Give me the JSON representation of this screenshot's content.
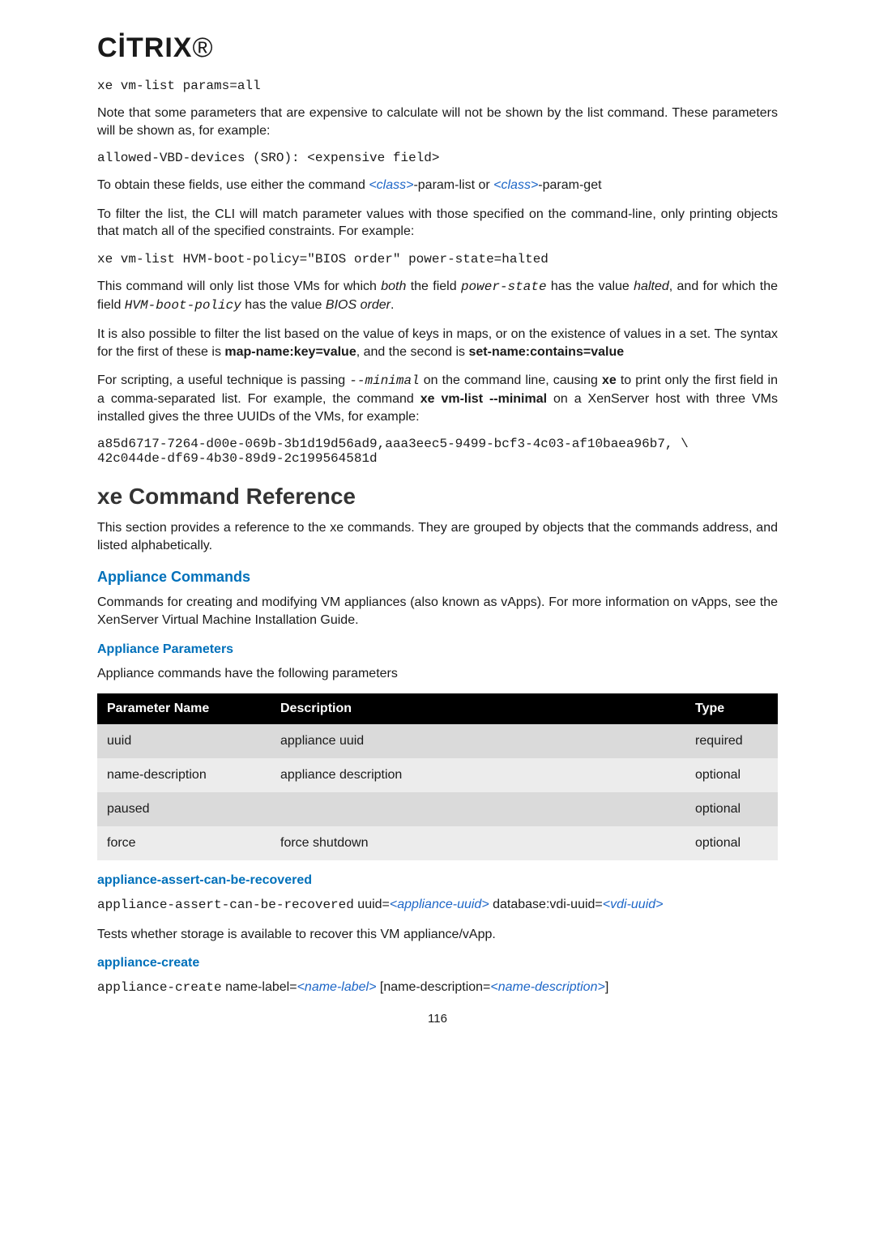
{
  "logo": "CİTRIX",
  "code_block_1": "xe vm-list params=all",
  "para_1": "Note that some parameters that are expensive to calculate will not be shown by the list command. These parameters will be shown as, for example:",
  "code_block_2": "allowed-VBD-devices (SRO): <expensive field>",
  "para_2": {
    "t0": "To obtain these fields, use either the command ",
    "c1": "<class>",
    "t1": "-param-list or ",
    "c2": "<class>",
    "t2": "-param-get"
  },
  "para_3": "To filter the list, the CLI will match parameter values with those specified on the command-line, only printing objects that match all of the specified constraints. For example:",
  "code_block_3": "xe vm-list HVM-boot-policy=\"BIOS order\" power-state=halted",
  "para_4": {
    "t0": "This command will only list those VMs for which ",
    "b0": "both",
    "t1": " the field ",
    "c0": "power-state",
    "t2": " has the value ",
    "i0": "halted",
    "t3": ", and for which the field ",
    "c1": "HVM-boot-policy",
    "t4": " has the value ",
    "i1": "BIOS order",
    "t5": "."
  },
  "para_5": {
    "t0": "It is also possible to filter the list based on the value of keys in maps, or on the existence of values in a set. The syntax for the first of these is ",
    "b0": "map-name:key=value",
    "t1": ", and the second is ",
    "b1": "set-name:contains=value"
  },
  "para_6": {
    "t0": "For scripting, a useful technique is passing ",
    "c0": "--minimal",
    "t1": " on the command line, causing ",
    "b0": "xe",
    "t2": " to print only the first field in a comma-separated list. For example, the command ",
    "b1": "xe vm-list --minimal",
    "t3": " on a XenServer host with three VMs installed gives the three UUIDs of the VMs, for example:"
  },
  "code_block_4": "a85d6717-7264-d00e-069b-3b1d19d56ad9,aaa3eec5-9499-bcf3-4c03-af10baea96b7, \\\n42c044de-df69-4b30-89d9-2c199564581d",
  "h2_ref": "xe Command Reference",
  "para_7": "This section provides a reference to the xe commands. They are grouped by objects that the commands address, and listed alphabetically.",
  "h3_appliance": "Appliance Commands",
  "para_8": "Commands for creating and modifying VM appliances (also known as vApps). For more information on vApps, see the XenServer Virtual Machine Installation Guide.",
  "h4_params": "Appliance Parameters",
  "para_9": "Appliance commands have the following parameters",
  "table": {
    "head": {
      "c0": "Parameter Name",
      "c1": "Description",
      "c2": "Type"
    },
    "rows": [
      {
        "c0": "uuid",
        "c1": "appliance uuid",
        "c2": "required"
      },
      {
        "c0": "name-description",
        "c1": "appliance description",
        "c2": "optional"
      },
      {
        "c0": "paused",
        "c1": "",
        "c2": "optional"
      },
      {
        "c0": "force",
        "c1": "force shutdown",
        "c2": "optional"
      }
    ]
  },
  "h4_assert": "appliance-assert-can-be-recovered",
  "cmd_assert": {
    "c0": "appliance-assert-can-be-recovered",
    "t0": " uuid=",
    "a0": "<appliance-uuid>",
    "t1": " database:vdi-uuid=",
    "a1": "<vdi-uuid>"
  },
  "para_10": "Tests whether storage is available to recover this VM appliance/vApp.",
  "h4_create": "appliance-create",
  "cmd_create": {
    "c0": "appliance-create",
    "t0": " name-label=",
    "a0": "<name-label>",
    "t1": " [name-description=",
    "a1": "<name-description>",
    "t2": "]"
  },
  "page_number": "116"
}
